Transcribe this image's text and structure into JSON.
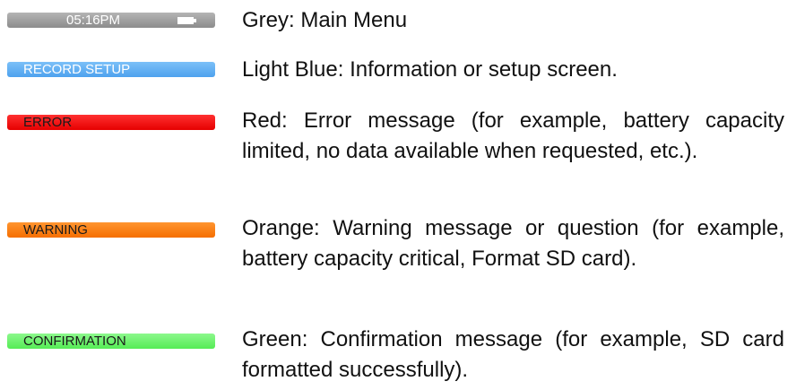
{
  "legend": [
    {
      "id": "grey",
      "bar_label": "05:16PM",
      "bar_color": "#a0a0a0",
      "description": "Grey: Main Menu",
      "icon": "battery-icon"
    },
    {
      "id": "blue",
      "bar_label": "RECORD SETUP",
      "bar_color": "#62b0f5",
      "description": "Light Blue: Information or setup screen."
    },
    {
      "id": "red",
      "bar_label": "ERROR",
      "bar_color": "#ff0d0d",
      "description": "Red: Error message (for example, battery capacity limited, no data available when requested, etc.)."
    },
    {
      "id": "orange",
      "bar_label": "WARNING",
      "bar_color": "#ff7d0a",
      "description": "Orange: Warning message or question (for example, battery capacity critical, Format SD card)."
    },
    {
      "id": "green",
      "bar_label": "CONFIRMATION",
      "bar_color": "#6cf56c",
      "description": "Green: Confirmation message (for example, SD card formatted successfully)."
    }
  ]
}
